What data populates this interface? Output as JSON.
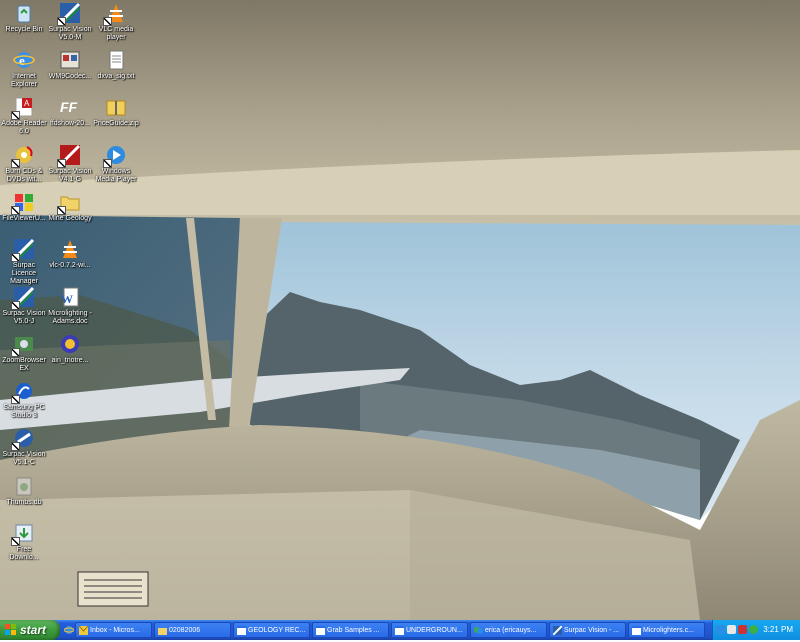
{
  "desktop": {
    "icons": [
      {
        "label": "Recycle Bin",
        "icon": "recycle-bin-icon"
      },
      {
        "label": "Surpac Vision\nV5.0-M",
        "icon": "surpac-icon"
      },
      {
        "label": "VLC media\nplayer",
        "icon": "vlc-icon"
      },
      {
        "label": "Internet\nExplorer",
        "icon": "internet-explorer-icon"
      },
      {
        "label": "WM9Codec...",
        "icon": "codec-icon"
      },
      {
        "label": "dxva_sig.txt",
        "icon": "text-file-icon"
      },
      {
        "label": "Adobe Reader\n6.0",
        "icon": "adobe-reader-icon"
      },
      {
        "label": "ffdshow-20...",
        "icon": "ffdshow-icon"
      },
      {
        "label": "PriceGuide.zip",
        "icon": "zip-folder-icon"
      },
      {
        "label": "Burn CDs &\nDVDs wit...",
        "icon": "burn-cd-icon"
      },
      {
        "label": "Surpac Vision\nV4.1-G",
        "icon": "surpac-red-icon"
      },
      {
        "label": "Windows\nMedia Player",
        "icon": "media-player-icon"
      },
      {
        "label": "FileViewerU...",
        "icon": "file-viewer-icon"
      },
      {
        "label": "Mine Geology",
        "icon": "folder-icon"
      },
      {
        "label": "Surpac Licence\nManager",
        "icon": "surpac-icon"
      },
      {
        "label": "vlc-0.7.2-wi...",
        "icon": "vlc-icon"
      },
      {
        "label": "Surpac Vision\nV5.0-J",
        "icon": "surpac-icon"
      },
      {
        "label": "Microlighting -\nAdams.doc",
        "icon": "word-doc-icon"
      },
      {
        "label": "ZoomBrowser\nEX",
        "icon": "zoombrowser-icon"
      },
      {
        "label": "ain_tnotre...",
        "icon": "disc-app-icon"
      },
      {
        "label": "Samsung PC\nStudio 3",
        "icon": "samsung-icon"
      },
      {
        "label": "Surpac Vision\nV5.1-C",
        "icon": "surpac-blue-icon"
      },
      {
        "label": "Thumbs.db",
        "icon": "thumbs-db-icon"
      },
      {
        "label": "Free\nDownlo...",
        "icon": "download-icon"
      }
    ]
  },
  "taskbar": {
    "start_label": "start",
    "tasks": [
      {
        "label": "Inbox - Micros...",
        "icon": "outlook-icon"
      },
      {
        "label": "02082006",
        "icon": "folder-icon"
      },
      {
        "label": "GEOLOGY REC...",
        "icon": "window-icon"
      },
      {
        "label": "Grab Samples ...",
        "icon": "window-icon"
      },
      {
        "label": "UNDERGROUN...",
        "icon": "window-icon"
      },
      {
        "label": "erica (ericauys...",
        "icon": "messenger-icon"
      },
      {
        "label": "Surpac Vision - ...",
        "icon": "surpac-icon"
      },
      {
        "label": "Microlighters.c...",
        "icon": "window-icon"
      }
    ],
    "clock": "3:21 PM"
  }
}
